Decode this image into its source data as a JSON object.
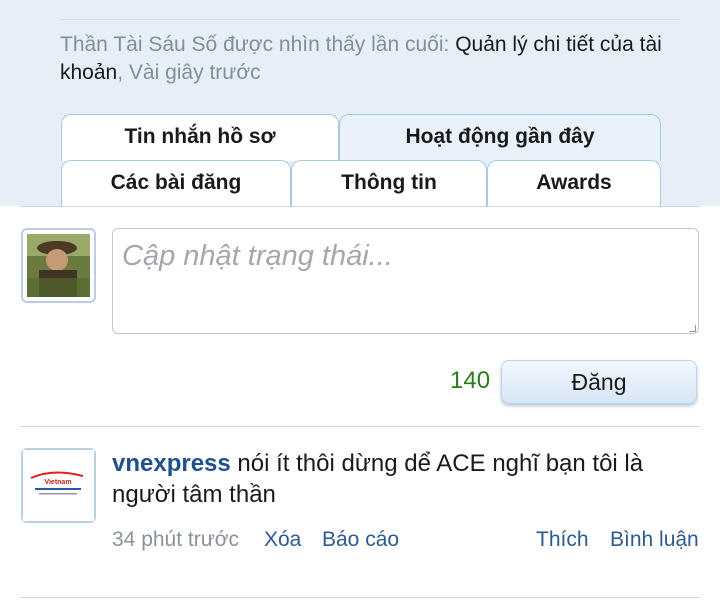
{
  "profile": {
    "last_seen_name": "Thần Tài Sáu Số",
    "last_seen_prefix": "được nhìn thấy lần cuối:",
    "last_seen_location": "Quản lý chi tiết của tài khoản",
    "last_seen_time": "Vài giây trước"
  },
  "tabs": {
    "profile_posts": "Tin nhắn hồ sơ",
    "recent_activity": "Hoạt động gần đây",
    "postings": "Các bài đăng",
    "information": "Thông tin",
    "awards": "Awards"
  },
  "status_update": {
    "placeholder": "Cập nhật trạng thái...",
    "char_count": "140",
    "submit_label": "Đăng"
  },
  "post": {
    "author": "vnexpress",
    "message": "nói ít thôi dừng dể ACE nghĩ bạn tôi là người tâm thần",
    "time": "34 phút trước",
    "delete_label": "Xóa",
    "report_label": "Báo cáo",
    "like_label": "Thích",
    "comment_label": "Bình luận",
    "avatar_text": "Vietnam"
  },
  "colors": {
    "header_bg": "#e6eff8",
    "tab_border": "#a9c6e2",
    "link_blue": "#2c5b94",
    "counter_green": "#2a7d1a"
  }
}
